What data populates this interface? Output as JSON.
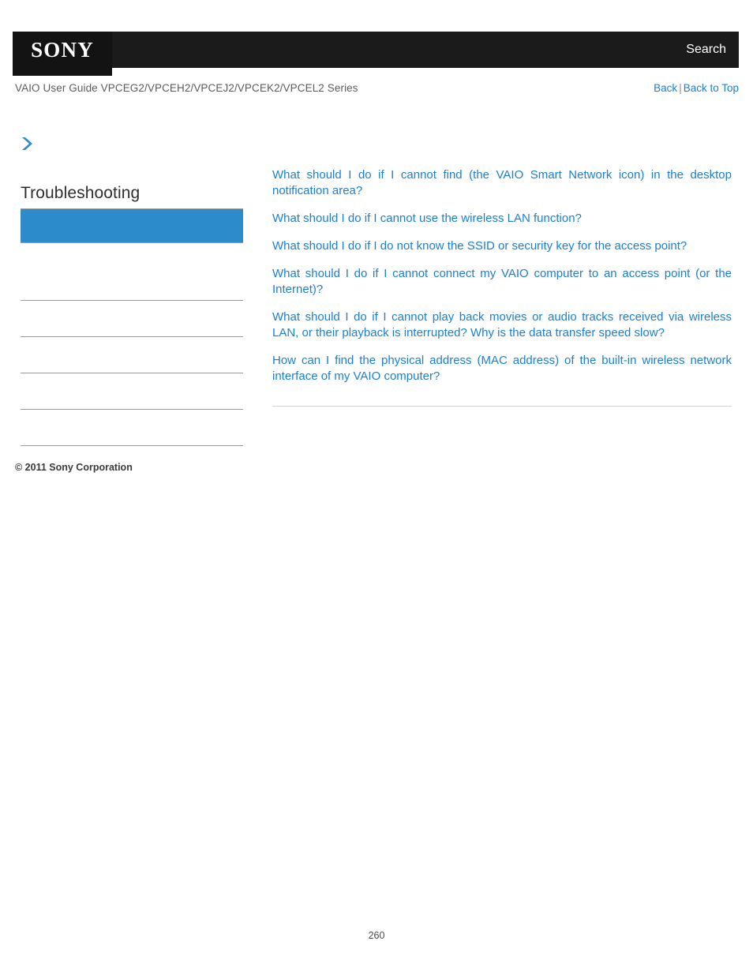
{
  "header": {
    "logo_text": "SONY",
    "search_label": "Search",
    "bar_color": "#1b1b1b",
    "logo_box_color": "#131313"
  },
  "breadcrumb": {
    "guide_title": "VAIO User Guide VPCEG2/VPCEH2/VPCEJ2/VPCEK2/VPCEL2 Series",
    "back_label": "Back",
    "separator": "|",
    "back_to_top_label": "Back to Top",
    "link_color": "#1a7fd4"
  },
  "chevron": {
    "icon": "chevron-right-icon",
    "color": "#2b8bcb"
  },
  "sidebar": {
    "title": "Troubleshooting",
    "selected_item": {
      "label": "",
      "background": "#2b8bcb"
    },
    "items": [
      {
        "label": ""
      },
      {
        "label": ""
      },
      {
        "label": ""
      },
      {
        "label": ""
      },
      {
        "label": ""
      }
    ]
  },
  "main": {
    "links": [
      "What should I do if I cannot find (the VAIO Smart Network icon) in the desktop notification area?",
      "What should I do if I cannot use the wireless LAN function?",
      "What should I do if I do not know the SSID or security key for the access point?",
      "What should I do if I cannot connect my VAIO computer to an access point (or the Internet)?",
      "What should I do if I cannot play back movies or audio tracks received via wireless LAN, or their playback is interrupted? Why is the data transfer speed slow?",
      "How can I find the physical address (MAC address) of the built-in wireless network interface of my VAIO computer?"
    ]
  },
  "footer": {
    "copyright": "© 2011 Sony Corporation",
    "page_number": "260"
  }
}
